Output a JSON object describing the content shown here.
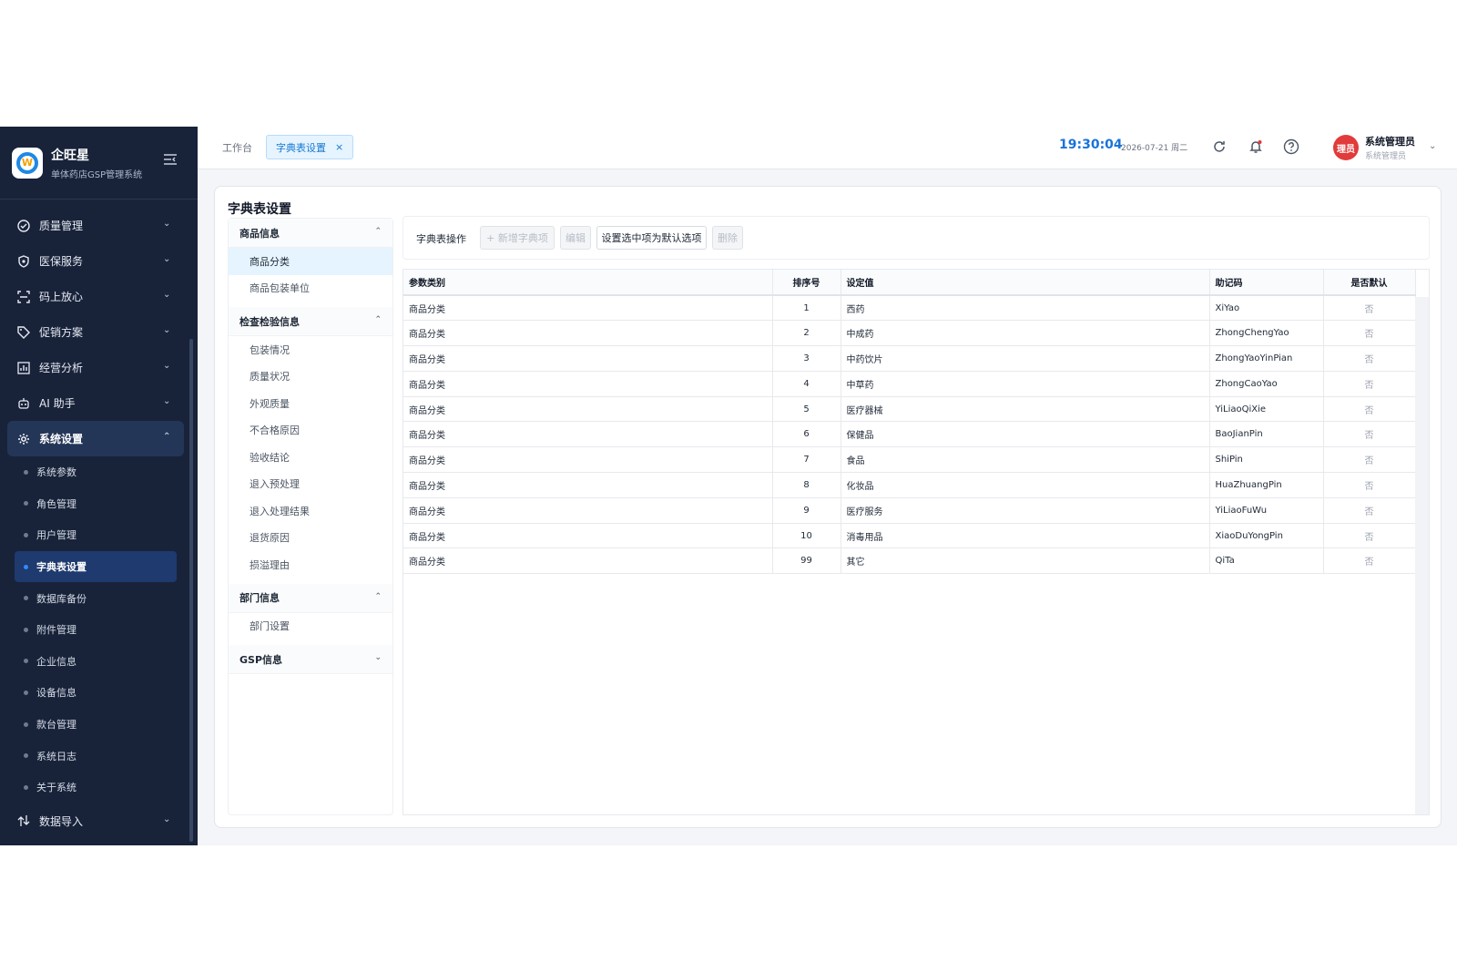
{
  "brand": {
    "title": "企旺星",
    "subtitle": "单体药店GSP管理系统",
    "logo_letter": "W"
  },
  "sidebar": {
    "items": [
      {
        "label": "质量管理",
        "icon": "quality-check-icon"
      },
      {
        "label": "医保服务",
        "icon": "shield-icon"
      },
      {
        "label": "码上放心",
        "icon": "scan-icon"
      },
      {
        "label": "促销方案",
        "icon": "tag-icon"
      },
      {
        "label": "经营分析",
        "icon": "chart-icon"
      },
      {
        "label": "AI 助手",
        "icon": "robot-icon"
      },
      {
        "label": "系统设置",
        "icon": "gear-icon"
      }
    ],
    "sub_items": [
      "系统参数",
      "角色管理",
      "用户管理",
      "字典表设置",
      "数据库备份",
      "附件管理",
      "企业信息",
      "设备信息",
      "款台管理",
      "系统日志",
      "关于系统"
    ],
    "last_item": {
      "label": "数据导入",
      "icon": "import-icon"
    }
  },
  "topbar": {
    "home_tab": "工作台",
    "active_tab": "字典表设置",
    "close_glyph": "×",
    "time": "19:30:04",
    "date": "2026-07-21 周二",
    "avatar_text": "理员",
    "user_name": "系统管理员",
    "user_role": "系统管理员"
  },
  "page": {
    "title": "字典表设置",
    "categories": [
      {
        "head": "商品信息",
        "items": [
          "商品分类",
          "商品包装单位"
        ]
      },
      {
        "head": "检查检验信息",
        "items": [
          "包装情况",
          "质量状况",
          "外观质量",
          "不合格原因",
          "验收结论",
          "退入预处理",
          "退入处理结果",
          "退货原因",
          "损溢理由"
        ]
      },
      {
        "head": "部门信息",
        "items": [
          "部门设置"
        ]
      },
      {
        "head": "GSP信息",
        "items": []
      }
    ],
    "ops": {
      "label": "字典表操作",
      "add": "+ 新增字典项",
      "edit": "编辑",
      "set_default": "设置选中项为默认选项",
      "delete": "删除"
    },
    "table": {
      "headers": [
        "参数类别",
        "排序号",
        "设定值",
        "助记码",
        "是否默认"
      ],
      "rows": [
        [
          "商品分类",
          "1",
          "西药",
          "XiYao",
          "否"
        ],
        [
          "商品分类",
          "2",
          "中成药",
          "ZhongChengYao",
          "否"
        ],
        [
          "商品分类",
          "3",
          "中药饮片",
          "ZhongYaoYinPian",
          "否"
        ],
        [
          "商品分类",
          "4",
          "中草药",
          "ZhongCaoYao",
          "否"
        ],
        [
          "商品分类",
          "5",
          "医疗器械",
          "YiLiaoQiXie",
          "否"
        ],
        [
          "商品分类",
          "6",
          "保健品",
          "BaoJianPin",
          "否"
        ],
        [
          "商品分类",
          "7",
          "食品",
          "ShiPin",
          "否"
        ],
        [
          "商品分类",
          "8",
          "化妆品",
          "HuaZhuangPin",
          "否"
        ],
        [
          "商品分类",
          "9",
          "医疗服务",
          "YiLiaoFuWu",
          "否"
        ],
        [
          "商品分类",
          "10",
          "消毒用品",
          "XiaoDuYongPin",
          "否"
        ],
        [
          "商品分类",
          "99",
          "其它",
          "QiTa",
          "否"
        ]
      ]
    }
  },
  "colors": {
    "sidebar_bg": "#18233a",
    "accent": "#1a73d9",
    "avatar": "#e23b3b"
  }
}
